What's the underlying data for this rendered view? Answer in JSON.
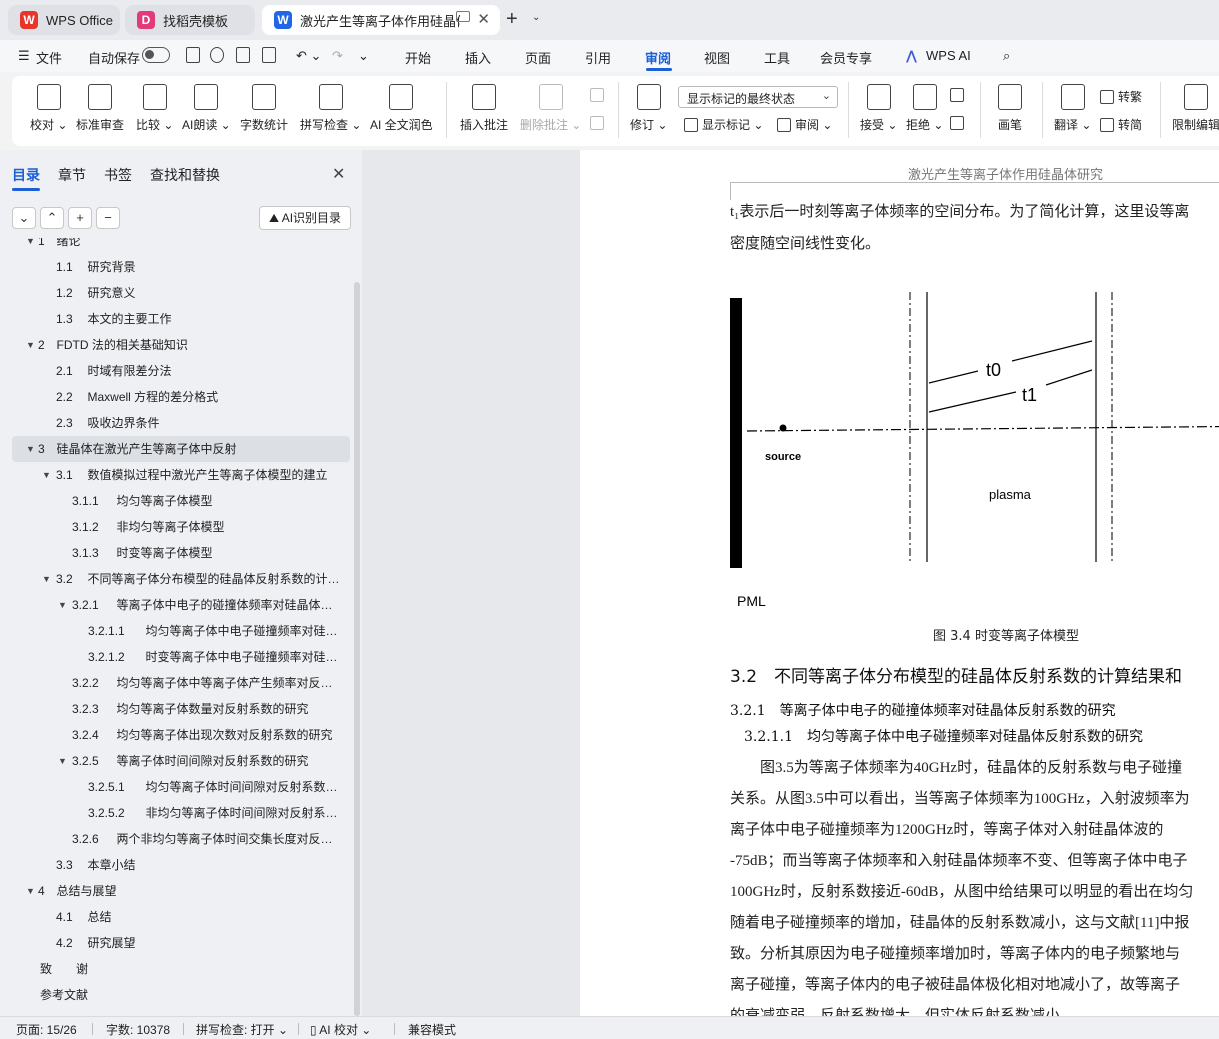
{
  "tabs": [
    {
      "label": "WPS Office",
      "logo": "W",
      "color": "#e8352a"
    },
    {
      "label": "找稻壳模板",
      "logo": "D",
      "color": "#e23a7b"
    },
    {
      "label": "激光产生等离子体作用硅晶体",
      "logo": "W",
      "color": "#2166e5"
    }
  ],
  "menu": {
    "file": "文件",
    "autosave": "自动保存",
    "items": [
      "开始",
      "插入",
      "页面",
      "引用",
      "审阅",
      "视图",
      "工具",
      "会员专享",
      "WPS AI"
    ],
    "active": "审阅"
  },
  "ribbon": {
    "proofread": "校对",
    "standard_review": "标准审查",
    "compare": "比较",
    "ai_read": "AI朗读",
    "word_count": "字数统计",
    "spell_check": "拼写检查",
    "ai_polish": "AI 全文润色",
    "insert_comment": "插入批注",
    "delete_comment": "删除批注",
    "revise": "修订",
    "markup_mode": "显示标记的最终状态",
    "show_markup": "显示标记",
    "review": "审阅",
    "accept": "接受",
    "reject": "拒绝",
    "pen": "画笔",
    "translate": "翻译",
    "to_traditional": "转繁",
    "to_simplified": "转简",
    "restrict": "限制编辑"
  },
  "nav": {
    "tabs": [
      "目录",
      "章节",
      "书签",
      "查找和替换"
    ],
    "ai_toc": "AI识别目录",
    "toc": [
      {
        "num": "1",
        "title": "绪论",
        "level": 1,
        "caret": true
      },
      {
        "num": "1.1",
        "title": "研究背景",
        "level": 2
      },
      {
        "num": "1.2",
        "title": "研究意义",
        "level": 2
      },
      {
        "num": "1.3",
        "title": "本文的主要工作",
        "level": 2
      },
      {
        "num": "2",
        "title": "FDTD 法的相关基础知识",
        "level": 1,
        "caret": true
      },
      {
        "num": "2.1",
        "title": "时域有限差分法",
        "level": 2
      },
      {
        "num": "2.2",
        "title": "Maxwell 方程的差分格式",
        "level": 2
      },
      {
        "num": "2.3",
        "title": "吸收边界条件",
        "level": 2
      },
      {
        "num": "3",
        "title": "硅晶体在激光产生等离子体中反射",
        "level": 1,
        "caret": true,
        "selected": true
      },
      {
        "num": "3.1",
        "title": "数值模拟过程中激光产生等离子体模型的建立",
        "level": 2,
        "caret": true
      },
      {
        "num": "3.1.1",
        "title": "均匀等离子体模型",
        "level": 3
      },
      {
        "num": "3.1.2",
        "title": "非均匀等离子体模型",
        "level": 3
      },
      {
        "num": "3.1.3",
        "title": "时变等离子体模型",
        "level": 3
      },
      {
        "num": "3.2",
        "title": "不同等离子体分布模型的硅晶体反射系数的计算结果和分析",
        "level": 2,
        "caret": true
      },
      {
        "num": "3.2.1",
        "title": "等离子体中电子的碰撞体频率对硅晶体反射系数的研究",
        "level": 3,
        "caret": true
      },
      {
        "num": "3.2.1.1",
        "title": "均匀等离子体中电子碰撞频率对硅晶体反射系数的研究",
        "level": 4
      },
      {
        "num": "3.2.1.2",
        "title": "时变等离子体中电子碰撞频率对硅晶体反射系数的研究",
        "level": 4
      },
      {
        "num": "3.2.2",
        "title": "均匀等离子体中等离子体产生频率对反射系数的研究",
        "level": 3
      },
      {
        "num": "3.2.3",
        "title": "均匀等离子体数量对反射系数的研究",
        "level": 3
      },
      {
        "num": "3.2.4",
        "title": "均匀等离子体出现次数对反射系数的研究",
        "level": 3
      },
      {
        "num": "3.2.5",
        "title": "等离子体时间间隙对反射系数的研究",
        "level": 3,
        "caret": true
      },
      {
        "num": "3.2.5.1",
        "title": "均匀等离子体时间间隙对反射系数的研究",
        "level": 4
      },
      {
        "num": "3.2.5.2",
        "title": "非均匀等离子体时间间隙对反射系数的研究",
        "level": 4
      },
      {
        "num": "3.2.6",
        "title": "两个非均匀等离子体时间交集长度对反射系数的研究",
        "level": 3
      },
      {
        "num": "3.3",
        "title": "本章小结",
        "level": 2
      },
      {
        "num": "4",
        "title": "总结与展望",
        "level": 1,
        "caret": true
      },
      {
        "num": "4.1",
        "title": "总结",
        "level": 2
      },
      {
        "num": "4.2",
        "title": "研究展望",
        "level": 2
      },
      {
        "num": "",
        "title": "致　　谢",
        "level": 0
      },
      {
        "num": "",
        "title": "参考文献",
        "level": 0
      }
    ]
  },
  "doc": {
    "header": "激光产生等离子体作用硅晶体研究",
    "para_top": [
      "t₁表示后一时刻等离子体频率的空间分布。为了简化计算，这里设等离",
      "密度随空间线性变化。"
    ],
    "figure": {
      "label_t0": "t0",
      "label_t1": "t1",
      "label_source": "source",
      "label_plasma": "plasma",
      "label_pml": "PML"
    },
    "caption": "图 3.4 时变等离子体模型",
    "h2": "3.2　不同等离子体分布模型的硅晶体反射系数的计算结果和",
    "h3": "3.2.1　等离子体中电子的碰撞体频率对硅晶体反射系数的研究",
    "h4": "3.2.1.1　均匀等离子体中电子碰撞频率对硅晶体反射系数的研究",
    "body": [
      "　　图3.5为等离子体频率为40GHz时，硅晶体的反射系数与电子碰撞",
      "关系。从图3.5中可以看出，当等离子体频率为100GHz，入射波频率为",
      "离子体中电子碰撞频率为1200GHz时，等离子体对入射硅晶体波的",
      "-75dB；而当等离子体频率和入射硅晶体频率不变、但等离子体中电子",
      "100GHz时，反射系数接近-60dB，从图中给结果可以明显的看出在均匀",
      "随着电子碰撞频率的增加，硅晶体的反射系数减小，这与文献[11]中报",
      "致。分析其原因为电子碰撞频率增加时，等离子体内的电子频繁地与",
      "离子碰撞，等离子体内的电子被硅晶体极化相对地减小了，故等离子",
      "的衰减变弱，反射系数增大，但实体反射系数减小"
    ]
  },
  "status": {
    "page": "页面: 15/26",
    "words": "字数: 10378",
    "spell": "拼写检查: 打开",
    "ai_proof": "AI 校对",
    "compat": "兼容模式"
  }
}
